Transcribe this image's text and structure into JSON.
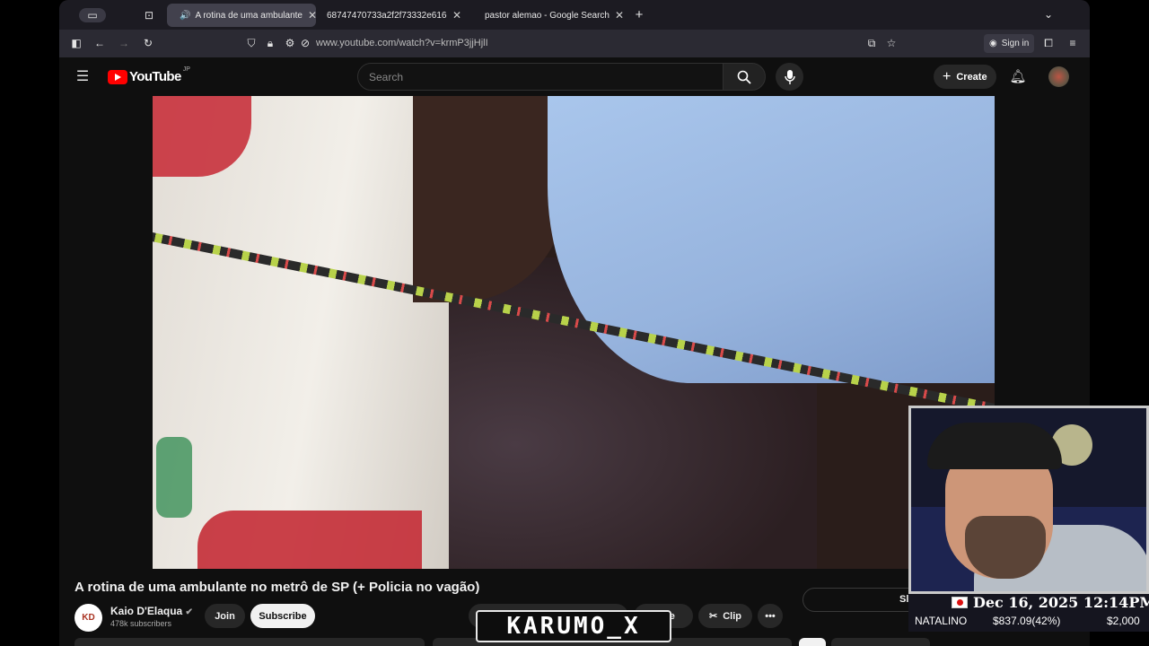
{
  "browser": {
    "tabs": [
      {
        "label": "A rotina de uma ambulante",
        "active": true
      },
      {
        "label": "68747470733a2f2f73332e616d617",
        "active": false
      },
      {
        "label": "pastor alemao - Google Search",
        "active": false
      }
    ],
    "new_tab": "+",
    "url": "www.youtube.com/watch?v=krmP3jjHjlI",
    "sign_in": "Sign in"
  },
  "youtube": {
    "logo_text": "YouTube",
    "region": "JP",
    "search_placeholder": "Search",
    "create_label": "Create"
  },
  "video": {
    "title": "A rotina de uma ambulante no metrô de SP (+ Policia no vagão)",
    "channel": "Kaio D'Elaqua",
    "avatar_text": "KD",
    "subscribers": "478k subscribers",
    "join_label": "Join",
    "subscribe_label": "Subscribe",
    "save_label": "Save",
    "clip_label": "Clip",
    "side_label": "Sl"
  },
  "overlay": {
    "watermark": "KARUMO_X",
    "date": "Dec 16, 2025 12:14PM",
    "ticker_name": "NATALINO",
    "ticker_value": "$837.09(42%)",
    "ticker_goal": "$2,000"
  },
  "colors": {
    "brand_red": "#ff0000",
    "bg": "#0f0f0f"
  }
}
